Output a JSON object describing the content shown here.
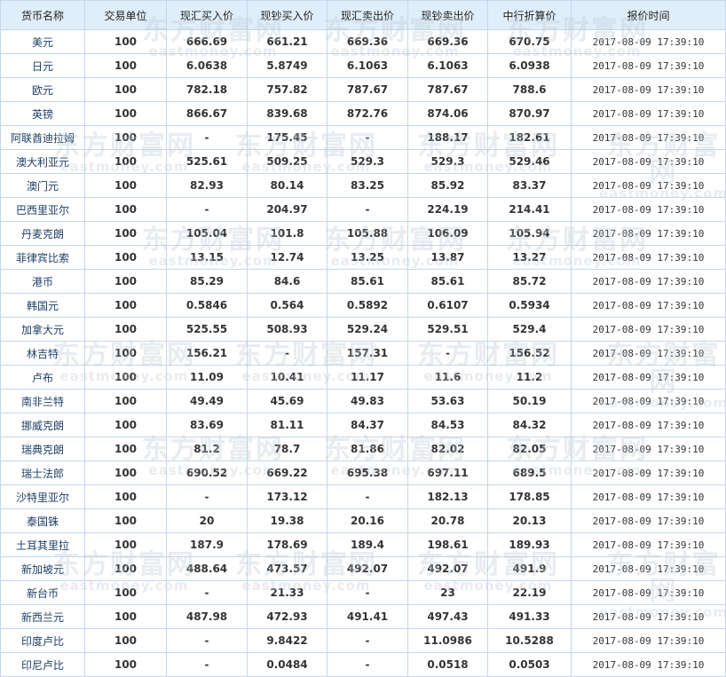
{
  "table": {
    "headers": [
      "货币名称",
      "交易单位",
      "现汇买入价",
      "现钞买入价",
      "现汇卖出价",
      "现钞卖出价",
      "中行折算价",
      "报价时间"
    ],
    "rows": [
      [
        "美元",
        "100",
        "666.69",
        "661.21",
        "669.36",
        "669.36",
        "670.75",
        "2017-08-09 17:39:10"
      ],
      [
        "日元",
        "100",
        "6.0638",
        "5.8749",
        "6.1063",
        "6.1063",
        "6.0938",
        "2017-08-09 17:39:10"
      ],
      [
        "欧元",
        "100",
        "782.18",
        "757.82",
        "787.67",
        "787.67",
        "788.6",
        "2017-08-09 17:39:10"
      ],
      [
        "英镑",
        "100",
        "866.67",
        "839.68",
        "872.76",
        "874.06",
        "870.97",
        "2017-08-09 17:39:10"
      ],
      [
        "阿联酋迪拉姆",
        "100",
        "-",
        "175.45",
        "-",
        "188.17",
        "182.61",
        "2017-08-09 17:39:10"
      ],
      [
        "澳大利亚元",
        "100",
        "525.61",
        "509.25",
        "529.3",
        "529.3",
        "529.46",
        "2017-08-09 17:39:10"
      ],
      [
        "澳门元",
        "100",
        "82.93",
        "80.14",
        "83.25",
        "85.92",
        "83.37",
        "2017-08-09 17:39:10"
      ],
      [
        "巴西里亚尔",
        "100",
        "-",
        "204.97",
        "-",
        "224.19",
        "214.41",
        "2017-08-09 17:39:10"
      ],
      [
        "丹麦克朗",
        "100",
        "105.04",
        "101.8",
        "105.88",
        "106.09",
        "105.94",
        "2017-08-09 17:39:10"
      ],
      [
        "菲律宾比索",
        "100",
        "13.15",
        "12.74",
        "13.25",
        "13.87",
        "13.27",
        "2017-08-09 17:39:10"
      ],
      [
        "港币",
        "100",
        "85.29",
        "84.6",
        "85.61",
        "85.61",
        "85.72",
        "2017-08-09 17:39:10"
      ],
      [
        "韩国元",
        "100",
        "0.5846",
        "0.564",
        "0.5892",
        "0.6107",
        "0.5934",
        "2017-08-09 17:39:10"
      ],
      [
        "加拿大元",
        "100",
        "525.55",
        "508.93",
        "529.24",
        "529.51",
        "529.4",
        "2017-08-09 17:39:10"
      ],
      [
        "林吉特",
        "100",
        "156.21",
        "-",
        "157.31",
        "-",
        "156.52",
        "2017-08-09 17:39:10"
      ],
      [
        "卢布",
        "100",
        "11.09",
        "10.41",
        "11.17",
        "11.6",
        "11.2",
        "2017-08-09 17:39:10"
      ],
      [
        "南非兰特",
        "100",
        "49.49",
        "45.69",
        "49.83",
        "53.63",
        "50.19",
        "2017-08-09 17:39:10"
      ],
      [
        "挪威克朗",
        "100",
        "83.69",
        "81.11",
        "84.37",
        "84.53",
        "84.32",
        "2017-08-09 17:39:10"
      ],
      [
        "瑞典克朗",
        "100",
        "81.2",
        "78.7",
        "81.86",
        "82.02",
        "82.05",
        "2017-08-09 17:39:10"
      ],
      [
        "瑞士法郎",
        "100",
        "690.52",
        "669.22",
        "695.38",
        "697.11",
        "689.5",
        "2017-08-09 17:39:10"
      ],
      [
        "沙特里亚尔",
        "100",
        "-",
        "173.12",
        "-",
        "182.13",
        "178.85",
        "2017-08-09 17:39:10"
      ],
      [
        "泰国铢",
        "100",
        "20",
        "19.38",
        "20.16",
        "20.78",
        "20.13",
        "2017-08-09 17:39:10"
      ],
      [
        "土耳其里拉",
        "100",
        "187.9",
        "178.69",
        "189.4",
        "198.61",
        "189.93",
        "2017-08-09 17:39:10"
      ],
      [
        "新加坡元",
        "100",
        "488.64",
        "473.57",
        "492.07",
        "492.07",
        "491.9",
        "2017-08-09 17:39:10"
      ],
      [
        "新台币",
        "100",
        "-",
        "21.33",
        "-",
        "23",
        "22.19",
        "2017-08-09 17:39:10"
      ],
      [
        "新西兰元",
        "100",
        "487.98",
        "472.93",
        "491.41",
        "497.43",
        "491.33",
        "2017-08-09 17:39:10"
      ],
      [
        "印度卢比",
        "100",
        "-",
        "9.8422",
        "-",
        "11.0986",
        "10.5288",
        "2017-08-09 17:39:10"
      ],
      [
        "印尼卢比",
        "100",
        "-",
        "0.0484",
        "-",
        "0.0518",
        "0.0503",
        "2017-08-09 17:39:10"
      ]
    ]
  },
  "watermark": {
    "cn": "东方财富网",
    "en": "eastmoney.com"
  }
}
